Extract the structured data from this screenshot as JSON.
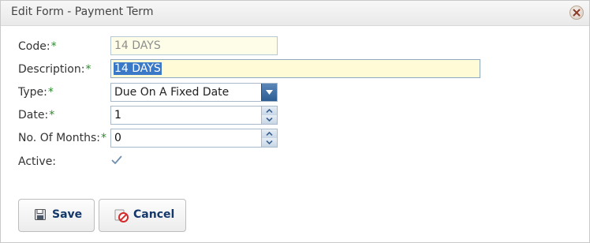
{
  "window": {
    "title": "Edit Form - Payment Term"
  },
  "form": {
    "code": {
      "label": "Code:",
      "required": "*",
      "value": "14 DAYS"
    },
    "description": {
      "label": "Description:",
      "required": "*",
      "value": "14 DAYS"
    },
    "type": {
      "label": "Type:",
      "required": "*",
      "value": "Due On A Fixed Date"
    },
    "date": {
      "label": "Date:",
      "required": "*",
      "value": "1"
    },
    "months": {
      "label": "No. Of Months:",
      "required": "*",
      "value": "0"
    },
    "active": {
      "label": "Active:",
      "checked": true
    }
  },
  "buttons": {
    "save": "Save",
    "cancel": "Cancel"
  },
  "icons": {
    "close": "close-icon",
    "save": "floppy-disk-icon",
    "cancel": "cancel-circle-icon",
    "checkbox": "checkmark-icon"
  },
  "colors": {
    "required": "#2a8a2a",
    "button_text": "#14376a",
    "selection": "#3a78c8"
  }
}
